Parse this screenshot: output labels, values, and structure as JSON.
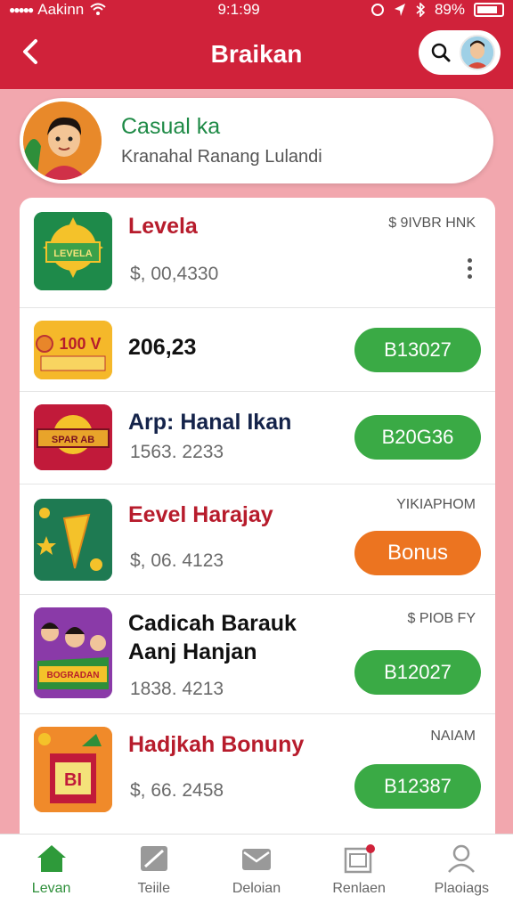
{
  "status": {
    "carrier": "Aakinn",
    "time": "9:1:99",
    "battery": "89%"
  },
  "header": {
    "title": "Braikan"
  },
  "profile": {
    "name": "Casual ka",
    "subtitle": "Kranahal Ranang Lulandi"
  },
  "items": [
    {
      "name": "Levela",
      "amount": "$, 00,4330",
      "tag": "$ 9IVBR HNK",
      "button": "",
      "thumb_text": "LEVELA"
    },
    {
      "name": "206,23",
      "amount": "",
      "tag": "",
      "button": "B13027",
      "thumb_text": "100 V"
    },
    {
      "name": "Arp: Hanal Ikan",
      "amount": "1563. 2233",
      "tag": "",
      "button": "B20G36",
      "thumb_text": "SPAR AB"
    },
    {
      "name": "Eevel Harajay",
      "amount": "$, 06. 4123",
      "tag": "YIKIAPHOM",
      "button": "Bonus",
      "thumb_text": ""
    },
    {
      "name_line1": "Cadicah Barauk",
      "name_line2": "Aanj Hanjan",
      "amount": "1838. 4213",
      "tag": "$ PIOB FY",
      "button": "B12027",
      "thumb_text": "BOGRADAN"
    },
    {
      "name": "Hadjkah Bonuny",
      "amount": "$, 66. 2458",
      "tag": "NAIAM",
      "button": "B12387",
      "thumb_text": "BI"
    }
  ],
  "nav": [
    {
      "label": "Levan",
      "icon": "home-icon"
    },
    {
      "label": "Teiile",
      "icon": "tag-icon"
    },
    {
      "label": "Deloian",
      "icon": "inbox-icon"
    },
    {
      "label": "Renlaen",
      "icon": "gift-icon"
    },
    {
      "label": "Plaoiags",
      "icon": "person-icon"
    }
  ]
}
